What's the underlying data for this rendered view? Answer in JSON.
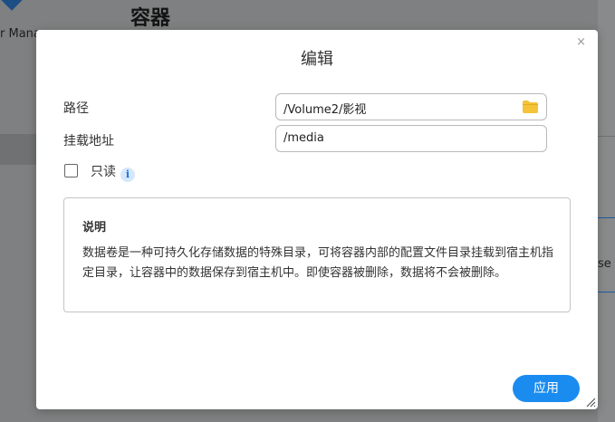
{
  "background": {
    "page_title": "容器",
    "app_name_fragment": "r Mana",
    "right_fragment": "se"
  },
  "dialog": {
    "title": "编辑",
    "close_glyph": "×",
    "path": {
      "label": "路径",
      "value": "/Volume2/影视"
    },
    "mount": {
      "label": "挂载地址",
      "value": "/media"
    },
    "readonly": {
      "label": "只读",
      "checked": false,
      "info_glyph": "i"
    },
    "note": {
      "title": "说明",
      "body": "数据卷是一种可持久化存储数据的特殊目录，可将容器内部的配置文件目录挂载到宿主机指定目录，让容器中的数据保存到宿主机中。即使容器被删除，数据将不会被删除。"
    },
    "apply_label": "应用"
  },
  "colors": {
    "accent": "#1a8cf0",
    "folder": "#f4c33a"
  }
}
